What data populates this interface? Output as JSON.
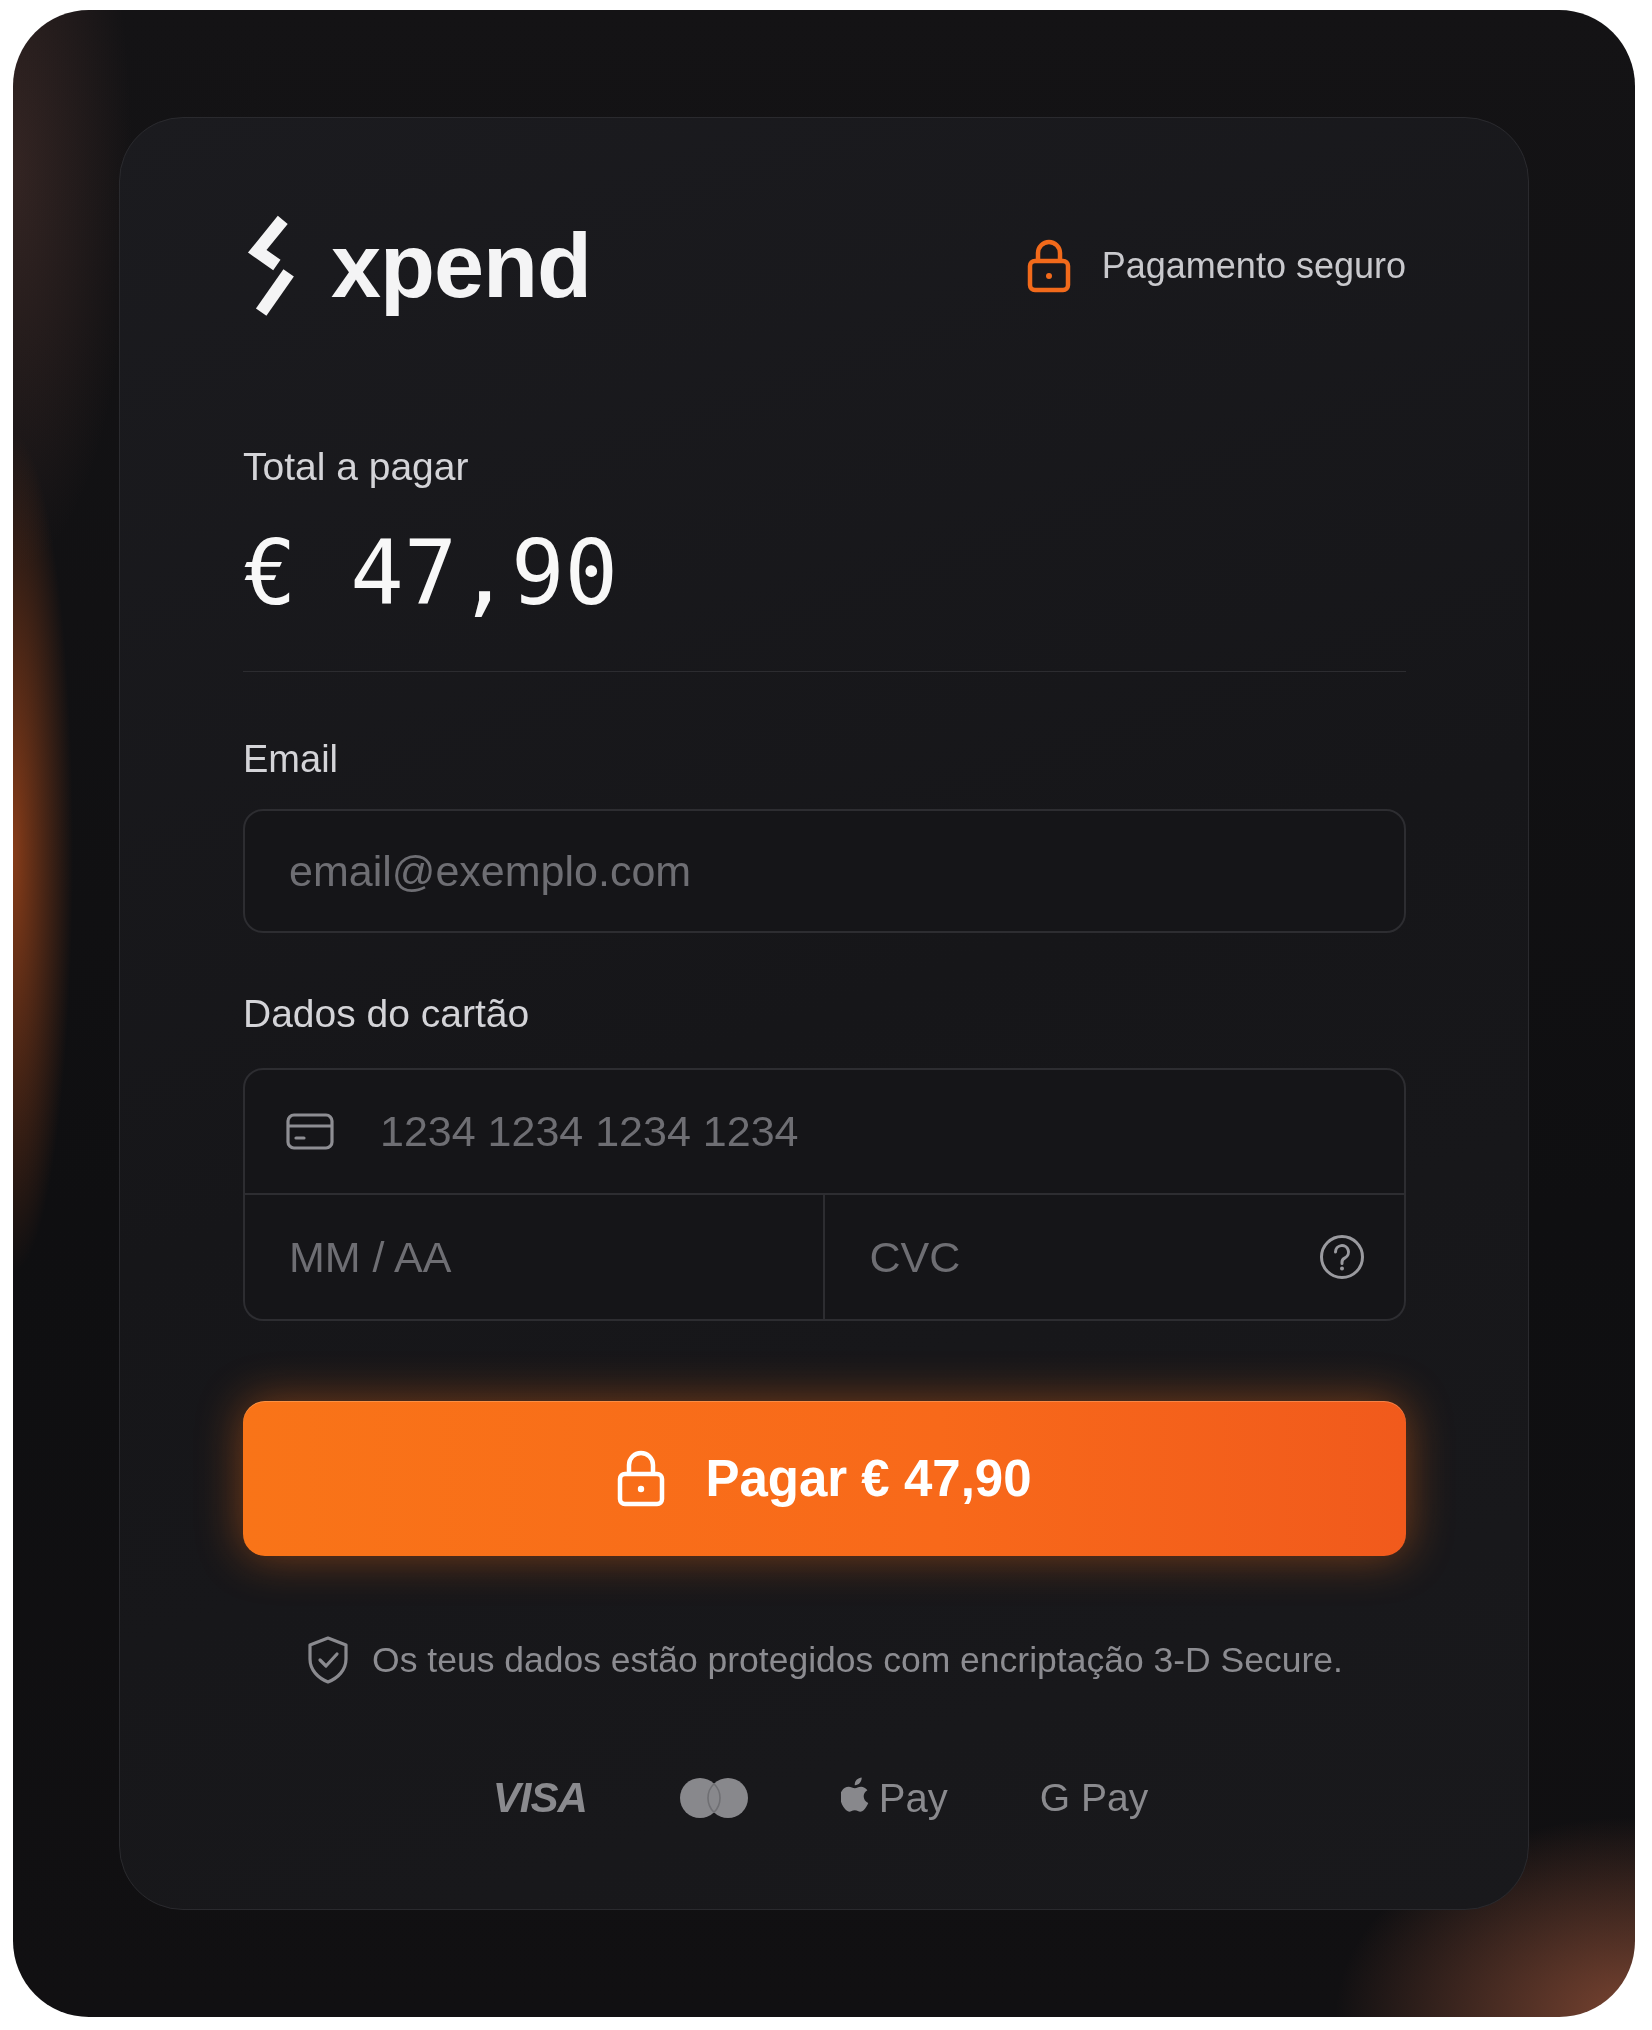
{
  "header": {
    "logo": {
      "name": "xpend"
    },
    "secure_badge": {
      "label": "Pagamento seguro"
    }
  },
  "total": {
    "label": "Total a pagar",
    "amount": "€ 47,90"
  },
  "email": {
    "label": "Email",
    "placeholder": "email@exemplo.com"
  },
  "card_details": {
    "label": "Dados do cartão",
    "number_placeholder": "1234 1234 1234 1234",
    "expiry_placeholder": "MM / AA",
    "cvc_placeholder": "CVC"
  },
  "pay_button": {
    "label": "Pagar € 47,90"
  },
  "security_note": "Os teus dados estão protegidos com encriptação 3-D Secure.",
  "payment_methods": [
    {
      "kind": "visa",
      "label": "VISA"
    },
    {
      "kind": "mastercard"
    },
    {
      "kind": "apple_pay",
      "label": "Pay"
    },
    {
      "kind": "google_pay",
      "label": "G Pay"
    }
  ]
}
